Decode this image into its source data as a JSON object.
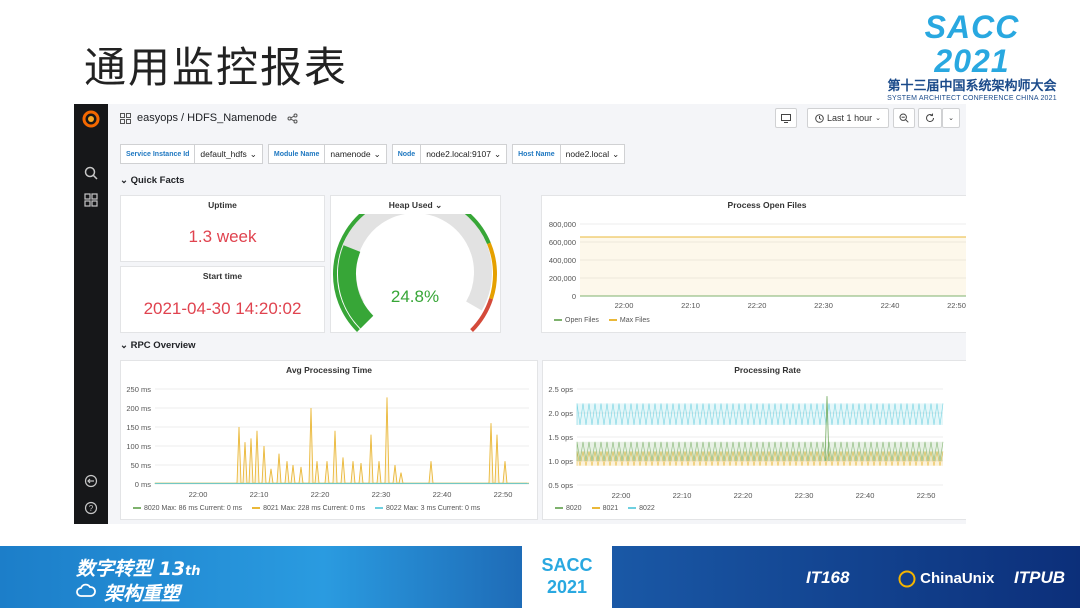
{
  "slide": {
    "title": "通用监控报表",
    "logo_big": "SACC 2021",
    "logo_cn": "第十三届中国系统架构师大会",
    "logo_en": "SYSTEM ARCHITECT CONFERENCE CHINA 2021"
  },
  "topbar": {
    "breadcrumb": "easyops / HDFS_Namenode",
    "time_range": "Last 1 hour"
  },
  "variables": [
    {
      "label": "Service Instance Id",
      "value": "default_hdfs"
    },
    {
      "label": "Module Name",
      "value": "namenode"
    },
    {
      "label": "Node",
      "value": "node2.local:9107"
    },
    {
      "label": "Host Name",
      "value": "node2.local"
    }
  ],
  "rows": {
    "quick_facts": "Quick Facts",
    "rpc_overview": "RPC Overview"
  },
  "panels": {
    "uptime": {
      "title": "Uptime",
      "value": "1.3 week"
    },
    "start_time": {
      "title": "Start time",
      "value": "2021-04-30 14:20:02"
    },
    "heap_used": {
      "title": "Heap Used",
      "value": "24.8%",
      "fraction": 0.248
    },
    "open_files": {
      "title": "Process Open Files"
    },
    "avg_proc": {
      "title": "Avg Processing Time"
    },
    "proc_rate": {
      "title": "Processing Rate"
    }
  },
  "chart_data": [
    {
      "type": "line",
      "title": "Process Open Files",
      "x": [
        "22:00",
        "22:10",
        "22:20",
        "22:30",
        "22:40",
        "22:50"
      ],
      "yticks": [
        "800,000",
        "600,000",
        "400,000",
        "200,000",
        "0"
      ],
      "ylim": [
        0,
        800000
      ],
      "series": [
        {
          "name": "Open Files",
          "color": "#7eb26d",
          "constant": 0
        },
        {
          "name": "Max Files",
          "color": "#eab839",
          "constant": 655360
        }
      ],
      "legend": "bottom-left"
    },
    {
      "type": "line",
      "title": "Avg Processing Time",
      "x": [
        "22:00",
        "22:10",
        "22:20",
        "22:30",
        "22:40",
        "22:50"
      ],
      "yticks": [
        "250 ms",
        "200 ms",
        "150 ms",
        "100 ms",
        "50 ms",
        "0 ms"
      ],
      "ylim": [
        0,
        250
      ],
      "series": [
        {
          "name": "8020",
          "color": "#7eb26d",
          "legend_text": "Max: 86 ms  Current: 0 ms"
        },
        {
          "name": "8021",
          "color": "#eab839",
          "legend_text": "Max: 228 ms  Current: 0 ms"
        },
        {
          "name": "8022",
          "color": "#6ed0e0",
          "legend_text": "Max: 3 ms  Current: 0 ms"
        }
      ],
      "legend": "bottom-left"
    },
    {
      "type": "line",
      "title": "Processing Rate",
      "x": [
        "22:00",
        "22:10",
        "22:20",
        "22:30",
        "22:40",
        "22:50"
      ],
      "yticks": [
        "2.5 ops",
        "2.0 ops",
        "1.5 ops",
        "1.0 ops",
        "0.5 ops"
      ],
      "ylim": [
        0.5,
        2.5
      ],
      "series": [
        {
          "name": "8020",
          "color": "#7eb26d",
          "band": [
            1.0,
            1.4
          ]
        },
        {
          "name": "8021",
          "color": "#eab839",
          "band": [
            0.9,
            1.2
          ]
        },
        {
          "name": "8022",
          "color": "#6ed0e0",
          "band": [
            1.75,
            2.2
          ]
        }
      ],
      "legend": "bottom-left"
    }
  ],
  "banner": {
    "line1": "数字转型 13",
    "line1_sub": "th",
    "line2": "架构重塑",
    "sacc1": "SACC",
    "sacc2": "2021",
    "sponsor1": "IT168",
    "sponsor2": "ChinaUnix",
    "sponsor3": "ITPUB"
  }
}
